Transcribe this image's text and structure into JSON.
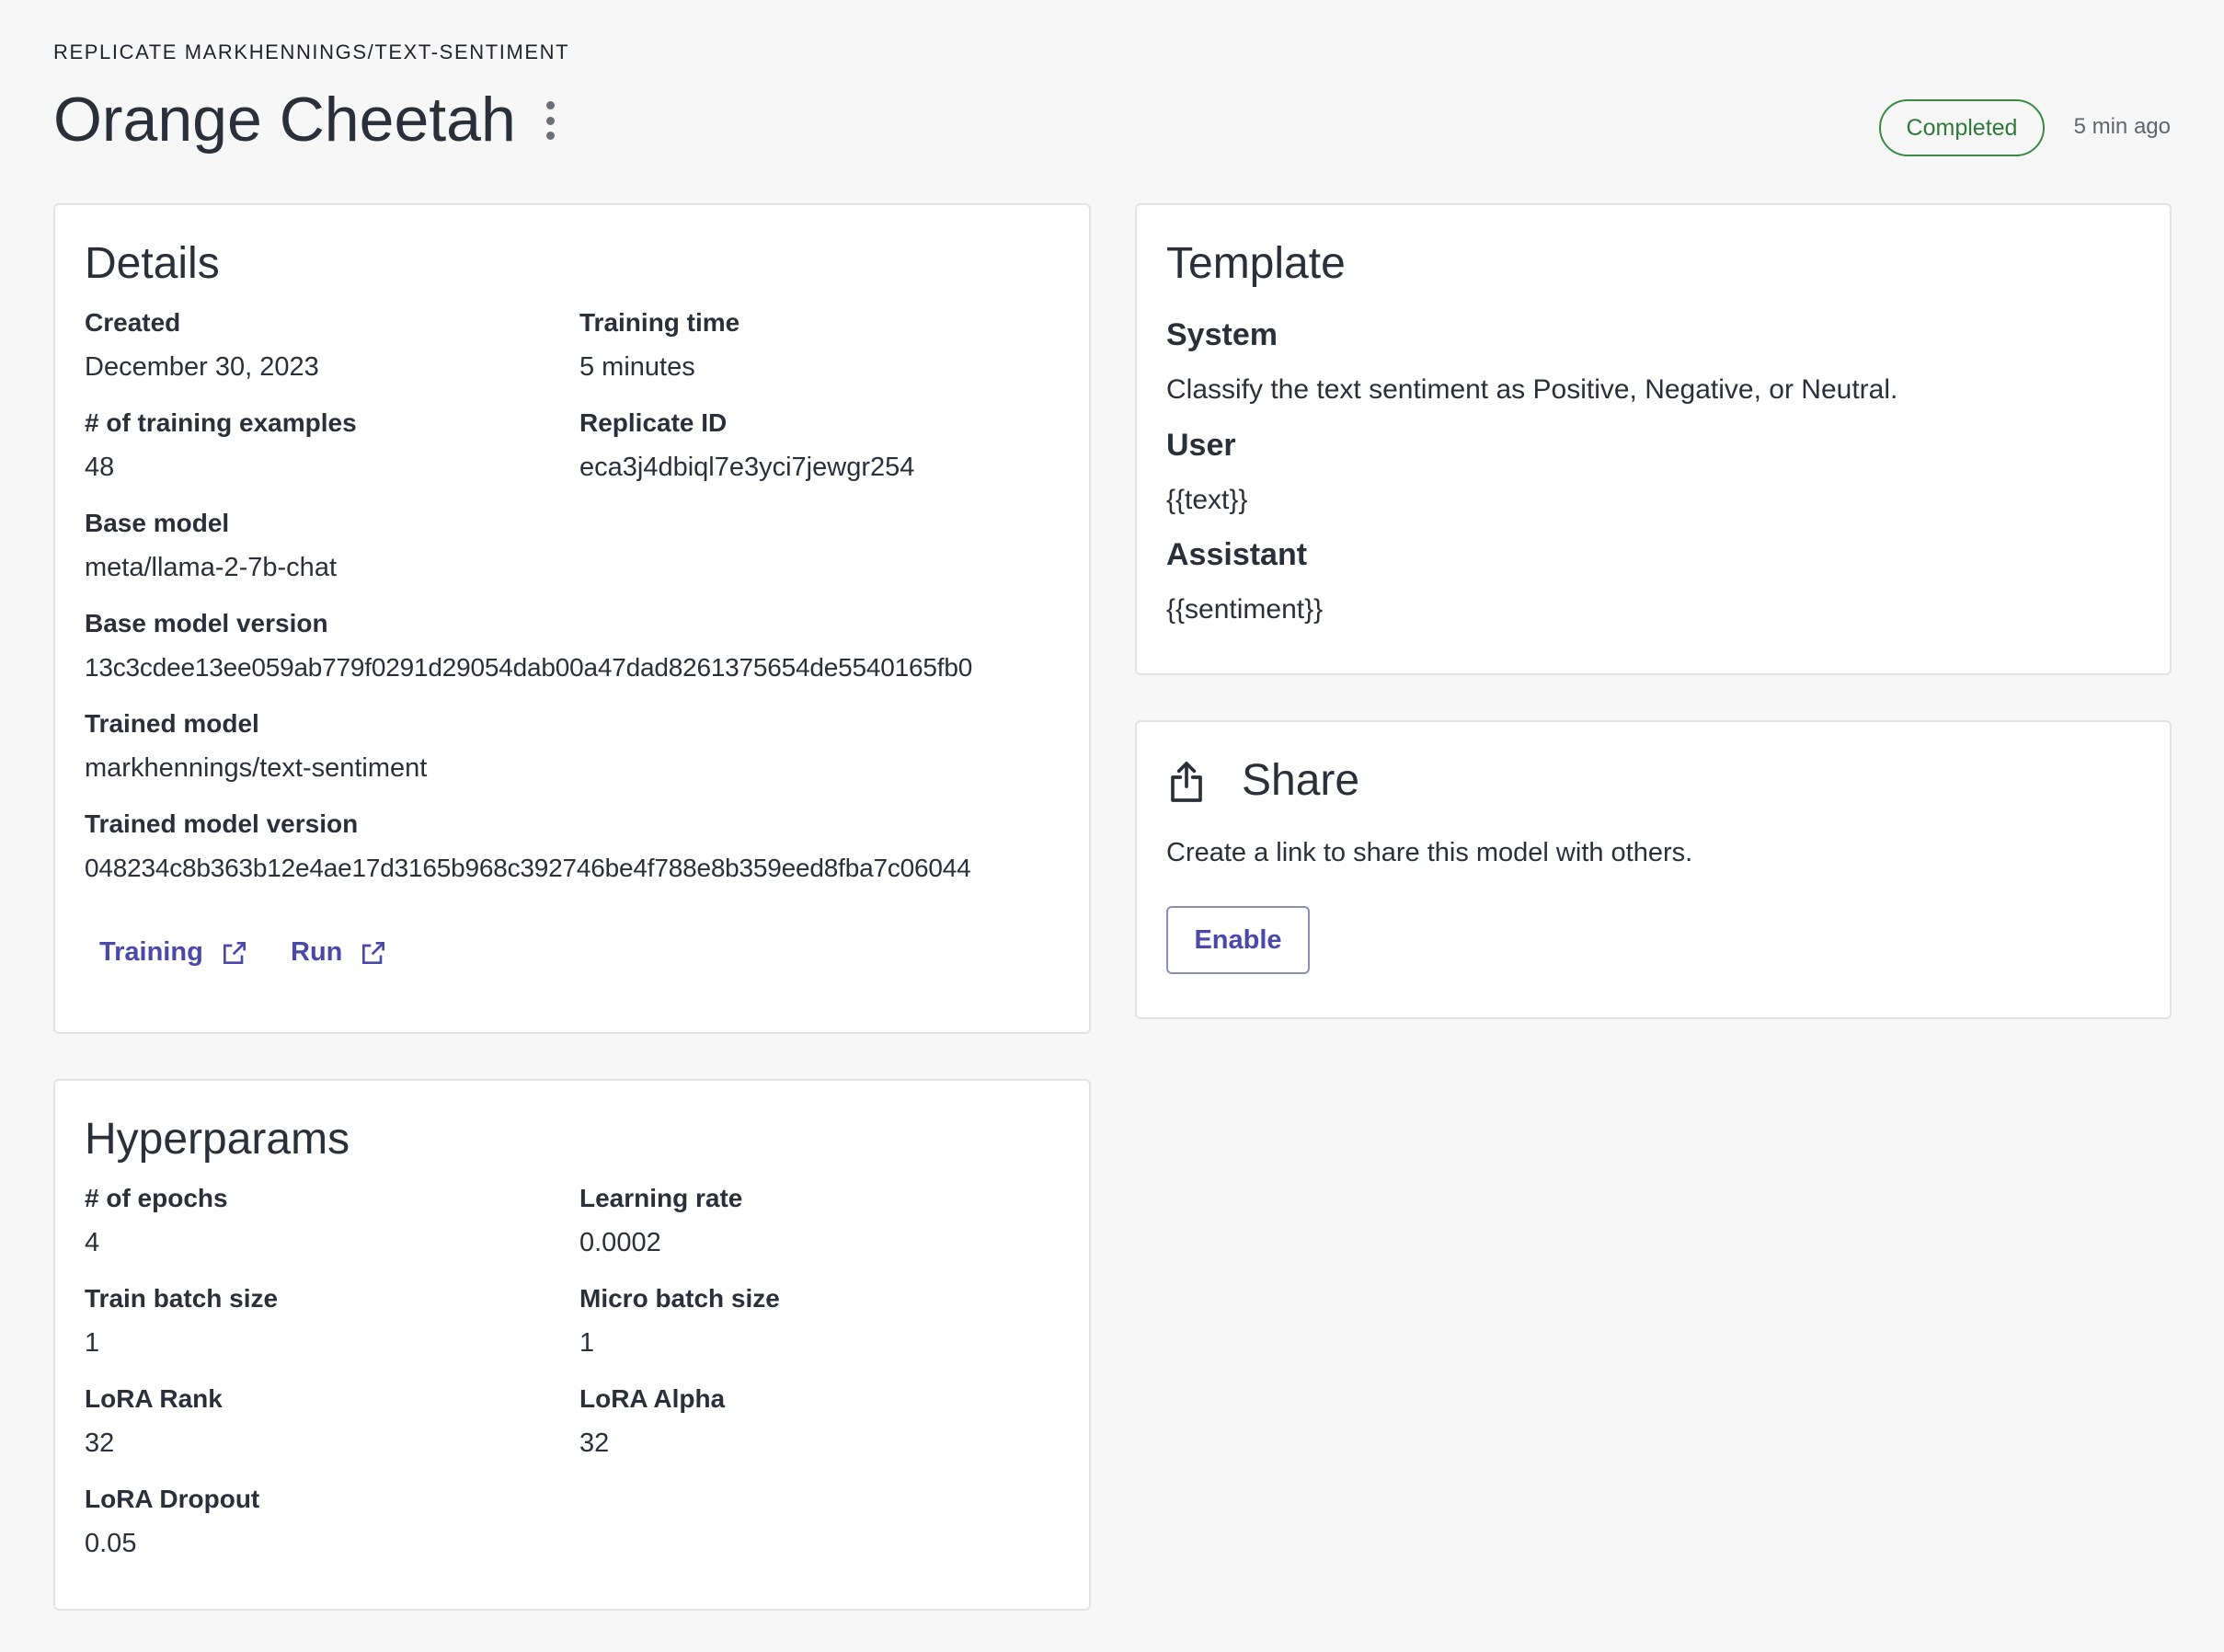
{
  "header": {
    "breadcrumb": "REPLICATE MARKHENNINGS/TEXT-SENTIMENT",
    "title": "Orange Cheetah",
    "status": "Completed",
    "timestamp": "5 min ago"
  },
  "details": {
    "title": "Details",
    "created_label": "Created",
    "created_value": "December 30, 2023",
    "training_time_label": "Training time",
    "training_time_value": "5 minutes",
    "examples_label": "# of training examples",
    "examples_value": "48",
    "replicate_id_label": "Replicate ID",
    "replicate_id_value": "eca3j4dbiql7e3yci7jewgr254",
    "base_model_label": "Base model",
    "base_model_value": "meta/llama-2-7b-chat",
    "base_model_version_label": "Base model version",
    "base_model_version_value": "13c3cdee13ee059ab779f0291d29054dab00a47dad8261375654de5540165fb0",
    "trained_model_label": "Trained model",
    "trained_model_value": "markhennings/text-sentiment",
    "trained_model_version_label": "Trained model version",
    "trained_model_version_value": "048234c8b363b12e4ae17d3165b968c392746be4f788e8b359eed8fba7c06044",
    "training_link": "Training",
    "run_link": "Run"
  },
  "template": {
    "title": "Template",
    "system_label": "System",
    "system_text": "Classify the text sentiment as Positive, Negative, or Neutral.",
    "user_label": "User",
    "user_text": "{{text}}",
    "assistant_label": "Assistant",
    "assistant_text": "{{sentiment}}"
  },
  "share": {
    "title": "Share",
    "description": "Create a link to share this model with others.",
    "enable_label": "Enable"
  },
  "hyperparams": {
    "title": "Hyperparams",
    "epochs_label": "# of epochs",
    "epochs_value": "4",
    "learning_rate_label": "Learning rate",
    "learning_rate_value": "0.0002",
    "train_batch_label": "Train batch size",
    "train_batch_value": "1",
    "micro_batch_label": "Micro batch size",
    "micro_batch_value": "1",
    "lora_rank_label": "LoRA Rank",
    "lora_rank_value": "32",
    "lora_alpha_label": "LoRA Alpha",
    "lora_alpha_value": "32",
    "lora_dropout_label": "LoRA Dropout",
    "lora_dropout_value": "0.05"
  },
  "icons": {
    "more": "more-vertical-icon",
    "external": "external-link-icon",
    "share": "share-icon"
  },
  "colors": {
    "accent": "#4a48a8",
    "success": "#2f7a3a"
  }
}
